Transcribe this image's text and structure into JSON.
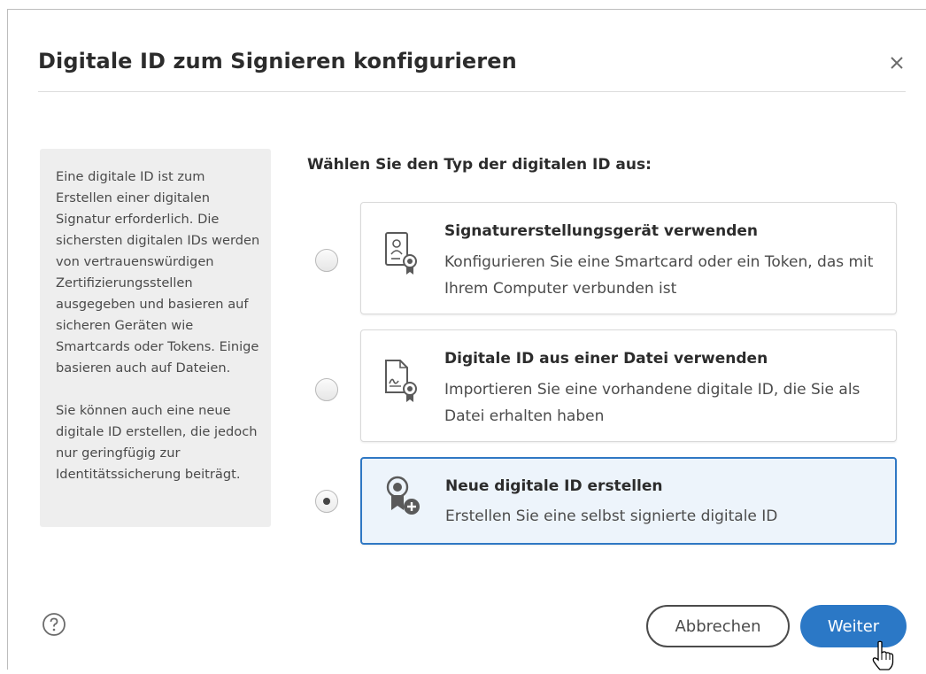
{
  "dialog": {
    "title": "Digitale ID zum Signieren konfigurieren",
    "close_icon": "close-icon"
  },
  "info": {
    "paragraph1": "Eine digitale ID ist zum Erstellen einer digitalen Signatur erforderlich. Die sichersten digitalen IDs werden von vertrauenswürdigen Zertifizierungsstellen ausgegeben und basieren auf sicheren Geräten wie Smartcards oder Tokens. Einige basieren auch auf Dateien.",
    "paragraph2": "Sie können auch eine neue digitale ID erstellen, die jedoch nur geringfügig zur Identitätssicherung beiträgt."
  },
  "options": {
    "heading": "Wählen Sie den Typ der digitalen ID aus:",
    "selected_index": 2,
    "items": [
      {
        "title": "Signaturerstellungsgerät verwenden",
        "description": "Konfigurieren Sie eine Smartcard oder ein Token, das mit Ihrem Computer verbunden ist",
        "icon": "certificate-device-icon",
        "selected": false
      },
      {
        "title": "Digitale ID aus einer Datei verwenden",
        "description": "Importieren Sie eine vorhandene digitale ID, die Sie als Datei erhalten haben",
        "icon": "certificate-file-icon",
        "selected": false
      },
      {
        "title": "Neue digitale ID erstellen",
        "description": "Erstellen Sie eine selbst signierte digitale ID",
        "icon": "new-certificate-icon",
        "selected": true
      }
    ]
  },
  "footer": {
    "help_icon": "help-icon",
    "cancel_label": "Abbrechen",
    "next_label": "Weiter"
  },
  "colors": {
    "accent": "#2b78c6",
    "selected_card_bg": "#edf4fb",
    "panel_bg": "#eeeeee"
  }
}
